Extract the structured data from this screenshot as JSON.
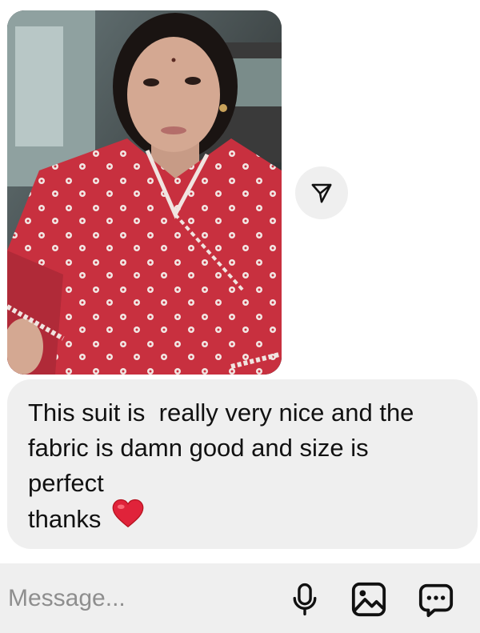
{
  "messages": {
    "photo": {
      "icon": "photo-message"
    },
    "share": {
      "icon": "paper-plane-icon"
    },
    "text_bubble": {
      "lines": [
        "This suit is  really very nice and the",
        "fabric is damn good and size is",
        "perfect",
        "thanks"
      ],
      "emoji": "red-heart-icon"
    }
  },
  "composer": {
    "placeholder": "Message...",
    "icons": [
      "microphone-icon",
      "image-icon",
      "sticker-icon"
    ]
  },
  "colors": {
    "bubble_bg": "#efefef",
    "text": "#111111",
    "placeholder": "#8e8e8e",
    "heart": "#e0233a"
  }
}
